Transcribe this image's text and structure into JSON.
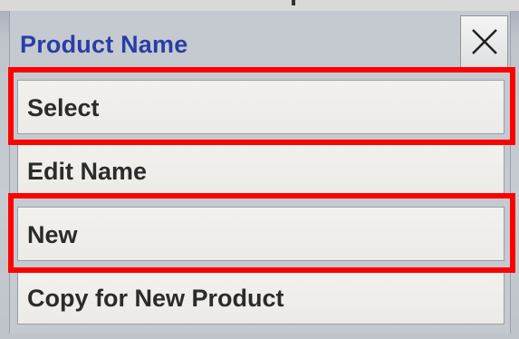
{
  "dialog": {
    "title": "Product Name",
    "close_icon": "close-icon"
  },
  "menu": {
    "items": [
      {
        "label": "Select",
        "highlighted": true
      },
      {
        "label": "Edit Name",
        "highlighted": false
      },
      {
        "label": "New",
        "highlighted": true
      },
      {
        "label": "Copy for New Product",
        "highlighted": false
      }
    ]
  },
  "colors": {
    "title": "#2a3ea6",
    "highlight": "#ff0000",
    "item_bg": "#efeeea"
  }
}
